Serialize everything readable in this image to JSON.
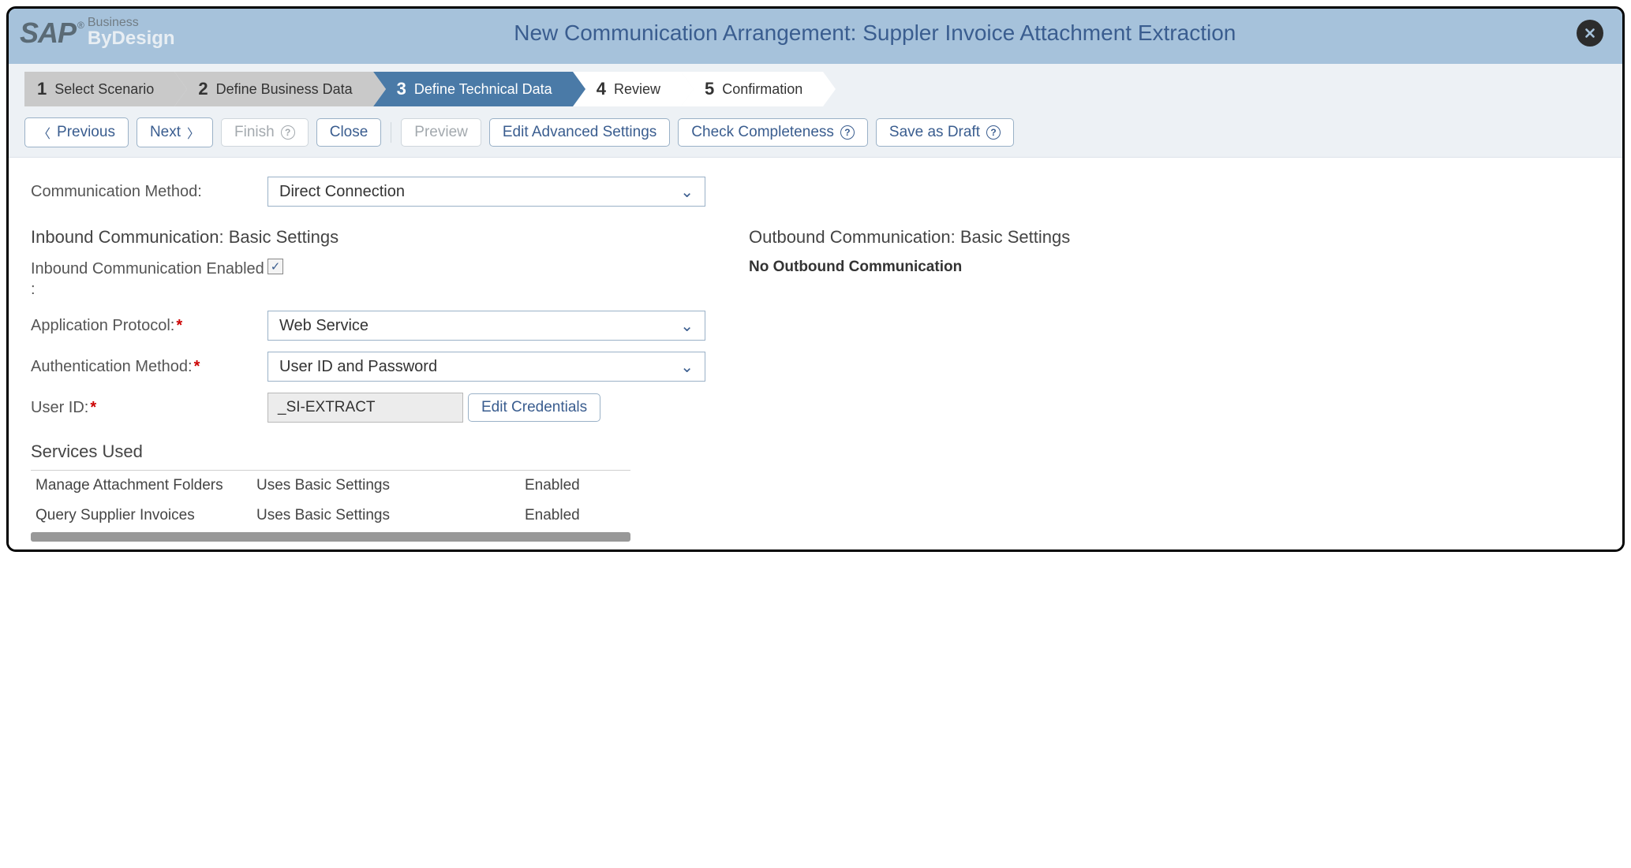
{
  "header": {
    "logo_sap": "SAP",
    "logo_reg": "®",
    "logo_business": "Business",
    "logo_bydesign": "ByDesign",
    "title": "New Communication Arrangement: Suppler Invoice Attachment Extraction"
  },
  "wizard": [
    {
      "num": "1",
      "label": "Select Scenario",
      "style": "grey"
    },
    {
      "num": "2",
      "label": "Define Business Data",
      "style": "grey"
    },
    {
      "num": "3",
      "label": "Define Technical Data",
      "style": "active"
    },
    {
      "num": "4",
      "label": "Review",
      "style": "white"
    },
    {
      "num": "5",
      "label": "Confirmation",
      "style": "white"
    }
  ],
  "buttons": {
    "previous": "Previous",
    "next": "Next",
    "finish": "Finish",
    "close": "Close",
    "preview": "Preview",
    "edit_advanced": "Edit Advanced Settings",
    "check_completeness": "Check Completeness",
    "save_draft": "Save as Draft"
  },
  "form": {
    "comm_method_label": "Communication Method:",
    "comm_method_value": "Direct Connection",
    "inbound_heading": "Inbound Communication: Basic Settings",
    "inbound_enabled_label": "Inbound Communication Enabled :",
    "inbound_enabled_checked": true,
    "app_protocol_label": "Application Protocol:",
    "app_protocol_value": "Web Service",
    "auth_method_label": "Authentication Method:",
    "auth_method_value": "User ID and Password",
    "user_id_label": "User ID:",
    "user_id_value": "_SI-EXTRACT",
    "edit_credentials": "Edit Credentials",
    "outbound_heading": "Outbound Communication: Basic Settings",
    "outbound_msg": "No Outbound Communication"
  },
  "services": {
    "heading": "Services Used",
    "rows": [
      {
        "name": "Manage Attachment Folders",
        "setting": "Uses Basic Settings",
        "status": "Enabled"
      },
      {
        "name": "Query Supplier Invoices",
        "setting": "Uses Basic Settings",
        "status": "Enabled"
      }
    ]
  }
}
